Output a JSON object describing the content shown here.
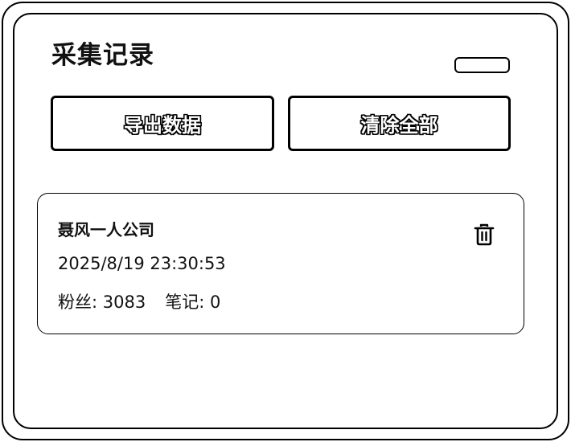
{
  "panel": {
    "title": "采集记录"
  },
  "actions": {
    "export_label": "导出数据",
    "clear_all_label": "清除全部"
  },
  "records": [
    {
      "name": "聂风一人公司",
      "timestamp": "2025/8/19 23:30:53",
      "followers_label": "粉丝: ",
      "followers": "3083",
      "notes_label": "笔记: ",
      "notes": "0",
      "delete_icon": "trash-icon"
    }
  ]
}
